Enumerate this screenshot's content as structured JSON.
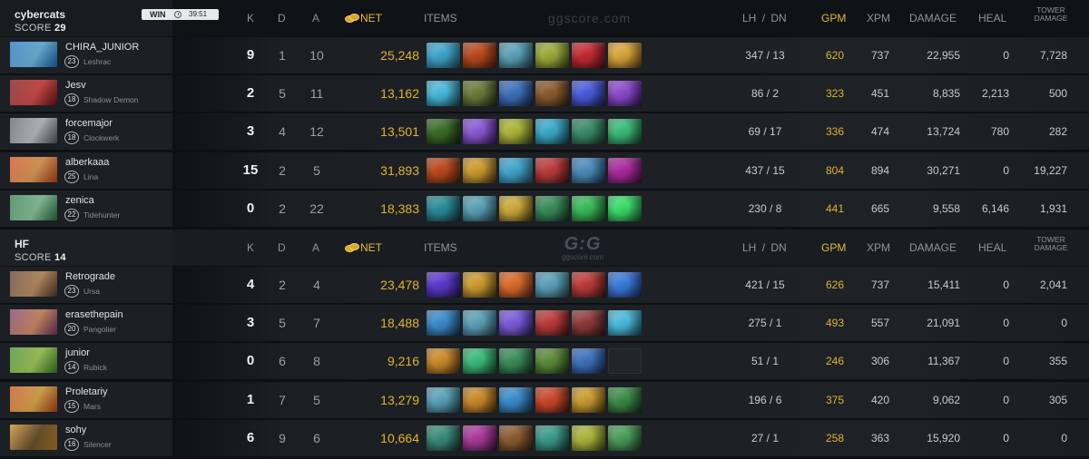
{
  "watermark": {
    "top_text": "ggscore.com",
    "logo_big": "G:G",
    "logo_small": "ggscore.com"
  },
  "columns": {
    "k": "K",
    "d": "D",
    "a": "A",
    "net": "NET",
    "items": "ITEMS",
    "lh": "LH",
    "sep": "/",
    "dn": "DN",
    "gpm": "GPM",
    "xpm": "XPM",
    "damage": "DAMAGE",
    "heal": "HEAL",
    "tower_1": "TOWER",
    "tower_2": "DAMAGE"
  },
  "teams": [
    {
      "name": "cybercats",
      "score_label": "SCORE",
      "score": "29",
      "badge": {
        "label": "WIN",
        "time": "39:51"
      },
      "players": [
        {
          "name": "CHIRA_JUNIOR",
          "level": "23",
          "hero": "Leshrac",
          "portrait": [
            "#1d6fbf",
            "#64c0f0"
          ],
          "k": "9",
          "d": "1",
          "a": "10",
          "net": "25,248",
          "items": [
            [
              "#3fa3c8",
              "#1a4256"
            ],
            [
              "#b8481c",
              "#3d1a0b"
            ],
            [
              "#5b9fb5",
              "#183a44"
            ],
            [
              "#9aa83a",
              "#2f3a12"
            ],
            [
              "#c02a33",
              "#3e0a10"
            ],
            [
              "#d4a43a",
              "#4a3410"
            ]
          ],
          "lh": "347",
          "dn": "13",
          "gpm": "620",
          "xpm": "737",
          "damage": "22,955",
          "heal": "0",
          "tower": "7,728"
        },
        {
          "name": "Jesv",
          "level": "18",
          "hero": "Shadow Demon",
          "portrait": [
            "#7a1010",
            "#e03a3a"
          ],
          "k": "2",
          "d": "5",
          "a": "11",
          "net": "13,162",
          "items": [
            [
              "#48b6d8",
              "#123a48"
            ],
            [
              "#6a7a38",
              "#1d2410"
            ],
            [
              "#3d6fb8",
              "#0f2240"
            ],
            [
              "#8a5a30",
              "#2a1a0d"
            ],
            [
              "#4a5ad8",
              "#151a48"
            ],
            [
              "#8a48c8",
              "#2a1048"
            ]
          ],
          "lh": "86",
          "dn": "2",
          "gpm": "323",
          "xpm": "451",
          "damage": "8,835",
          "heal": "2,213",
          "tower": "500"
        },
        {
          "name": "forcemajor",
          "level": "18",
          "hero": "Clockwerk",
          "portrait": [
            "#5a6066",
            "#c8ccd0"
          ],
          "k": "3",
          "d": "4",
          "a": "12",
          "net": "13,501",
          "items": [
            [
              "#3a6a28",
              "#0f1e0a"
            ],
            [
              "#8a58d0",
              "#2a1048"
            ],
            [
              "#aab23a",
              "#343a10"
            ],
            [
              "#3aa8c8",
              "#0f3440"
            ],
            [
              "#3a8a68",
              "#0f2a1e"
            ],
            [
              "#3ab878",
              "#0f3a22"
            ]
          ],
          "lh": "69",
          "dn": "17",
          "gpm": "336",
          "xpm": "474",
          "damage": "13,724",
          "heal": "780",
          "tower": "282"
        },
        {
          "name": "alberkaaa",
          "level": "25",
          "hero": "Lina",
          "portrait": [
            "#d0481c",
            "#f3a04a"
          ],
          "k": "15",
          "d": "2",
          "a": "5",
          "net": "31,893",
          "items": [
            [
              "#b8481c",
              "#3d1a0b"
            ],
            [
              "#c89a30",
              "#3e2c0d"
            ],
            [
              "#3fa3c8",
              "#1a4256"
            ],
            [
              "#b83a3a",
              "#3a1010"
            ],
            [
              "#4a8ab8",
              "#122840"
            ],
            [
              "#a82a9a",
              "#380d33"
            ]
          ],
          "lh": "437",
          "dn": "15",
          "gpm": "804",
          "xpm": "894",
          "damage": "30,271",
          "heal": "0",
          "tower": "19,227"
        },
        {
          "name": "zenica",
          "level": "22",
          "hero": "Tidehunter",
          "portrait": [
            "#2a7a48",
            "#8ad0a0"
          ],
          "k": "0",
          "d": "2",
          "a": "22",
          "net": "18,383",
          "items": [
            [
              "#2a8a98",
              "#0d2a30"
            ],
            [
              "#5b9fb5",
              "#183a44"
            ],
            [
              "#c8a83a",
              "#3a2e0d"
            ],
            [
              "#3a8a58",
              "#0f2a1a"
            ],
            [
              "#3ab858",
              "#0f3a18"
            ],
            [
              "#3ad868",
              "#104a20"
            ]
          ],
          "lh": "230",
          "dn": "8",
          "gpm": "441",
          "xpm": "665",
          "damage": "9,558",
          "heal": "6,146",
          "tower": "1,931"
        }
      ]
    },
    {
      "name": "HF",
      "score_label": "SCORE",
      "score": "14",
      "badge": null,
      "players": [
        {
          "name": "Retrograde",
          "level": "23",
          "hero": "Ursa",
          "portrait": [
            "#5a3a28",
            "#c8905a"
          ],
          "k": "4",
          "d": "2",
          "a": "4",
          "net": "23,478",
          "items": [
            [
              "#5a38c8",
              "#1a1048"
            ],
            [
              "#c89a30",
              "#3e2c0d"
            ],
            [
              "#d8682a",
              "#4a1e0b"
            ],
            [
              "#5b9fb5",
              "#183a44"
            ],
            [
              "#b83a3a",
              "#3a1010"
            ],
            [
              "#3a78d8",
              "#0f2248"
            ]
          ],
          "lh": "421",
          "dn": "15",
          "gpm": "626",
          "xpm": "737",
          "damage": "15,411",
          "heal": "0",
          "tower": "2,041"
        },
        {
          "name": "erasethepain",
          "level": "20",
          "hero": "Pangolier",
          "portrait": [
            "#7a3a68",
            "#e08a5a"
          ],
          "k": "3",
          "d": "5",
          "a": "7",
          "net": "18,488",
          "items": [
            [
              "#3a8ac8",
              "#0f2a40"
            ],
            [
              "#5b9fb5",
              "#183a44"
            ],
            [
              "#7a5ad8",
              "#201848"
            ],
            [
              "#b83a3a",
              "#3a1010"
            ],
            [
              "#8a3a3a",
              "#2a1010"
            ],
            [
              "#4ab8d8",
              "#104048"
            ]
          ],
          "lh": "275",
          "dn": "1",
          "gpm": "493",
          "xpm": "557",
          "damage": "21,091",
          "heal": "0",
          "tower": "0"
        },
        {
          "name": "junior",
          "level": "14",
          "hero": "Rubick",
          "portrait": [
            "#3a8a28",
            "#a8d84a"
          ],
          "k": "0",
          "d": "6",
          "a": "8",
          "net": "9,216",
          "items": [
            [
              "#c8882a",
              "#3a240b"
            ],
            [
              "#3ab878",
              "#0f3a22"
            ],
            [
              "#3a8a58",
              "#0f2a1a"
            ],
            [
              "#5a8a38",
              "#1a2a10"
            ],
            [
              "#3d6fb8",
              "#0f2240"
            ]
          ],
          "lh": "51",
          "dn": "1",
          "gpm": "246",
          "xpm": "306",
          "damage": "11,367",
          "heal": "0",
          "tower": "355"
        },
        {
          "name": "Proletariy",
          "level": "15",
          "hero": "Mars",
          "portrait": [
            "#c84a1c",
            "#f0b03a"
          ],
          "k": "1",
          "d": "7",
          "a": "5",
          "net": "13,279",
          "items": [
            [
              "#5b9fb5",
              "#183a44"
            ],
            [
              "#c8882a",
              "#3a240b"
            ],
            [
              "#3a8ac8",
              "#0f2a40"
            ],
            [
              "#c8482a",
              "#3a140b"
            ],
            [
              "#c89a30",
              "#3e2c0d"
            ],
            [
              "#3a8a48",
              "#0f2a14"
            ]
          ],
          "lh": "196",
          "dn": "6",
          "gpm": "375",
          "xpm": "420",
          "damage": "9,062",
          "heal": "0",
          "tower": "305"
        },
        {
          "name": "sohy",
          "level": "16",
          "hero": "Silencer",
          "portrait": [
            "#c8882a",
            "#604010"
          ],
          "k": "6",
          "d": "9",
          "a": "6",
          "net": "10,664",
          "items": [
            [
              "#3a8a78",
              "#0f2a24"
            ],
            [
              "#a83a9a",
              "#380d33"
            ],
            [
              "#8a5a30",
              "#2a1a0d"
            ],
            [
              "#3a9a88",
              "#0f302a"
            ],
            [
              "#aab23a",
              "#343a10"
            ],
            [
              "#4a9a58",
              "#143018"
            ]
          ],
          "lh": "27",
          "dn": "1",
          "gpm": "258",
          "xpm": "363",
          "damage": "15,920",
          "heal": "0",
          "tower": "0"
        }
      ]
    }
  ]
}
